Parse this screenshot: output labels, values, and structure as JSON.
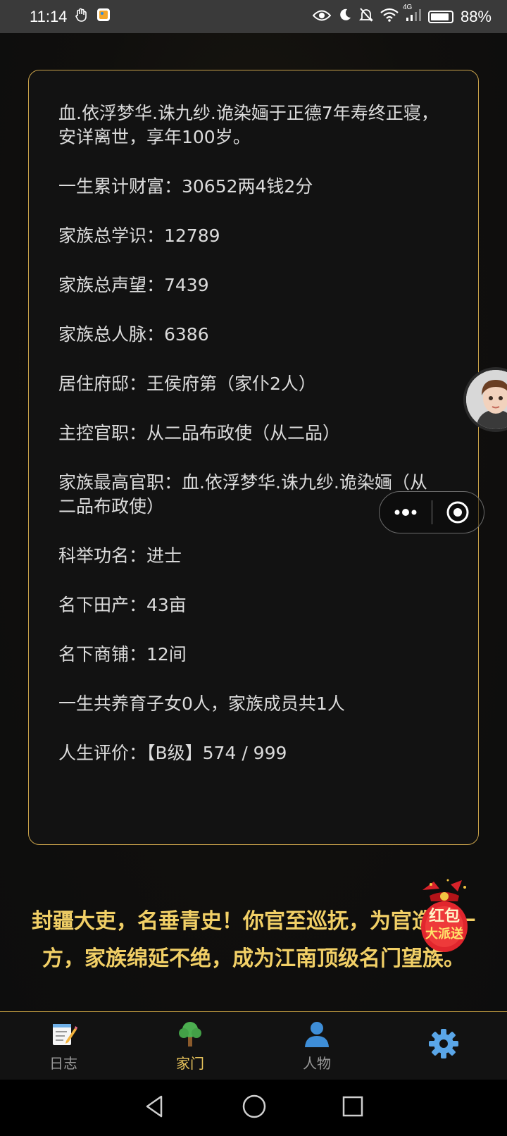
{
  "status_bar": {
    "time": "11:14",
    "network": "4G",
    "battery": "88%",
    "battery_level": 0.88,
    "icons": [
      "hand-icon",
      "gallery-app-icon",
      "eye-icon",
      "moon-icon",
      "bell-off-icon",
      "wifi-icon",
      "signal-icon",
      "battery-icon"
    ]
  },
  "summary": {
    "lines": [
      "血.依浮梦华.诛九纱.诡染婳于正德7年寿终正寝，安详离世，享年100岁。",
      "一生累计财富：30652两4钱2分",
      "家族总学识：12789",
      "家族总声望：7439",
      "家族总人脉：6386",
      "居住府邸：王侯府第（家仆2人）",
      "主控官职：从二品布政使（从二品）",
      "家族最高官职：血.依浮梦华.诛九纱.诡染婳（从二品布政使）",
      "科举功名：进士",
      "名下田产：43亩",
      "名下商铺：12间",
      "一生共养育子女0人，家族成员共1人",
      "人生评价：【B级】574 / 999"
    ]
  },
  "conclusion": "封疆大吏，名垂青史！你官至巡抚，为官造福一方，家族绵延不绝，成为江南顶级名门望族。",
  "red_packet": {
    "line1": "红包",
    "line2": "大派送"
  },
  "tabs": [
    {
      "label": "日志",
      "icon": "memo-icon",
      "active": false
    },
    {
      "label": "家门",
      "icon": "tree-icon",
      "active": true
    },
    {
      "label": "人物",
      "icon": "person-icon",
      "active": false
    },
    {
      "label": "",
      "icon": "gear-icon",
      "active": false
    }
  ],
  "colors": {
    "accent": "#e8c45c",
    "border": "#c9a24a",
    "background": "#0f0f0f"
  }
}
